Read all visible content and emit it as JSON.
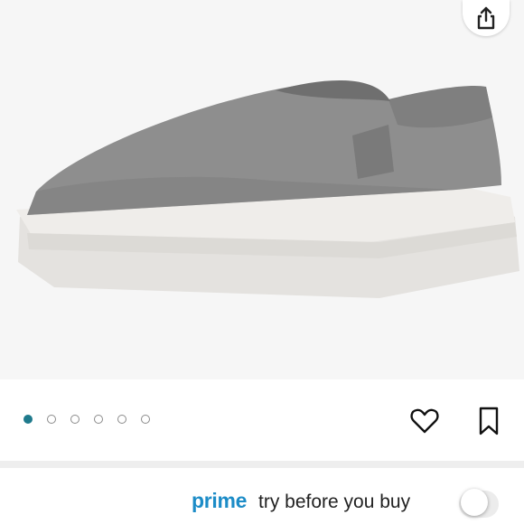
{
  "header": {
    "share_icon": "share-upload-icon"
  },
  "product_image": {
    "description_icon": "slip-on-sneaker-image",
    "upper_color": "#8e8e8e",
    "sole_color": "#e7e5e2"
  },
  "carousel": {
    "total_images": 6,
    "active_index": 0,
    "active_color": "#1f7a8c"
  },
  "actions": {
    "wishlist_icon": "heart-icon",
    "save_icon": "bookmark-icon"
  },
  "prime": {
    "brand": "prime",
    "tagline": "try before you buy",
    "brand_color": "#1c8cc7",
    "toggle_on": false
  }
}
